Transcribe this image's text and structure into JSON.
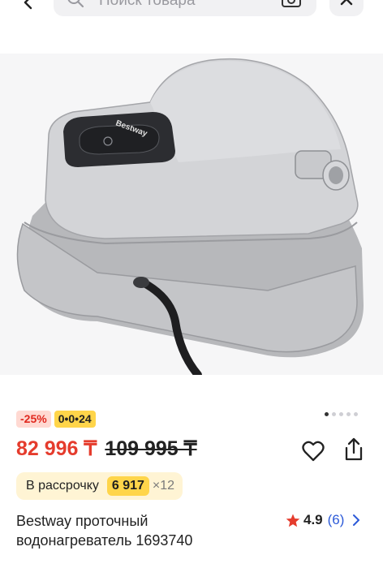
{
  "header": {
    "search_placeholder": "Поиск товара"
  },
  "gallery": {
    "image_alt": "Bestway проточный водонагреватель",
    "product_brand_text": "Bestway",
    "total_slides": 5,
    "active_slide": 1
  },
  "badges": {
    "discount": "-25%",
    "timer": "0•0•24"
  },
  "price": {
    "current": "82 996 ₸",
    "old": "109 995 ₸"
  },
  "installment": {
    "label": "В рассрочку",
    "amount": "6 917",
    "months": "×12"
  },
  "product": {
    "title": "Bestway проточный водонагреватель 1693740"
  },
  "rating": {
    "value": "4.9",
    "count": "(6)"
  },
  "colors": {
    "accent_red": "#e53c2d",
    "accent_yellow": "#ffd54a",
    "link_blue": "#2c5ad8"
  },
  "icons": [
    "back-arrow-icon",
    "search-icon",
    "camera-icon",
    "close-icon",
    "heart-icon",
    "share-icon",
    "star-icon",
    "chevron-right-icon"
  ]
}
